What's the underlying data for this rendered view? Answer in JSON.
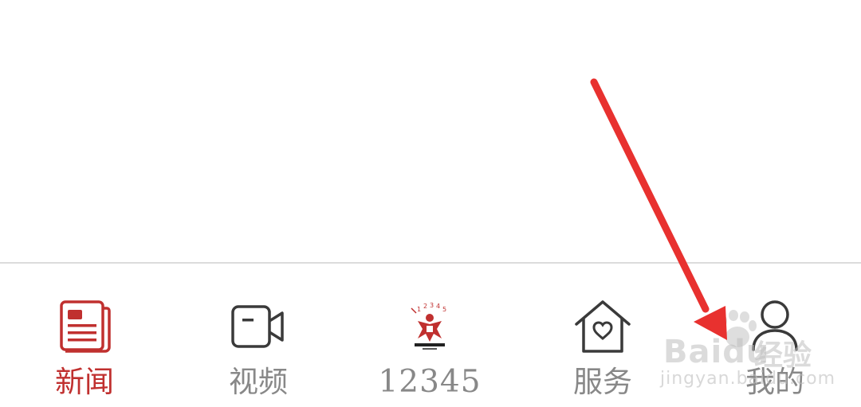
{
  "tab_bar": {
    "tabs": [
      {
        "id": "news",
        "label": "新闻",
        "icon": "newspaper-icon",
        "active": true
      },
      {
        "id": "video",
        "label": "视频",
        "icon": "video-camera-icon",
        "active": false
      },
      {
        "id": "hotline",
        "label": "12345",
        "icon": "hotline-logo-icon",
        "active": false
      },
      {
        "id": "service",
        "label": "服务",
        "icon": "house-heart-icon",
        "active": false
      },
      {
        "id": "mine",
        "label": "我的",
        "icon": "user-icon",
        "active": false
      }
    ],
    "hotline_logo_digits": [
      "1",
      "2",
      "3",
      "4",
      "5"
    ]
  },
  "watermark": {
    "brand": "Bai",
    "brand_tail": "du",
    "cn_text": "经验",
    "url": "jingyan.baidu.com"
  },
  "colors": {
    "active": "#c0302f",
    "inactive": "#888888",
    "icon_stroke": "#3a3a3a",
    "annotation_arrow": "#e8312f",
    "divider": "#dcdcdc"
  }
}
